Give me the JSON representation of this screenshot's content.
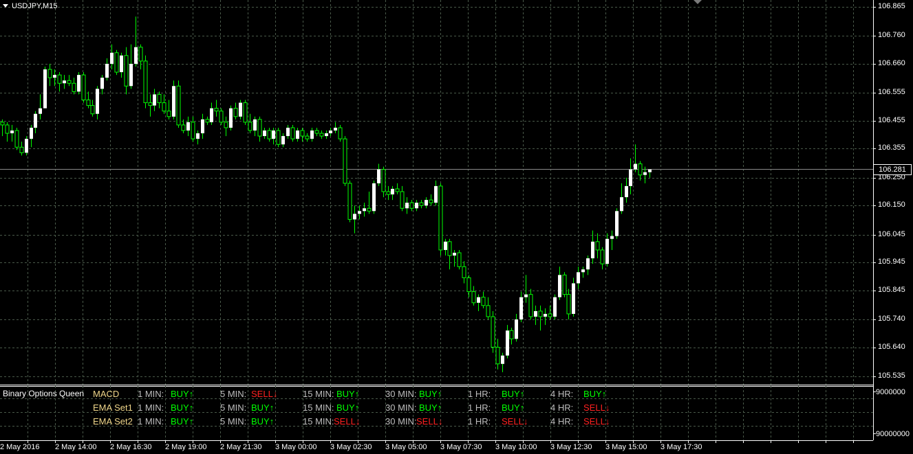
{
  "chart": {
    "symbol_label": "USDJPY,M15",
    "current_price": "106.281",
    "price_labels": [
      "106.865",
      "106.760",
      "106.660",
      "106.555",
      "106.455",
      "106.355",
      "106.250",
      "106.150",
      "106.045",
      "105.945",
      "105.845",
      "105.740",
      "105.640",
      "105.535"
    ],
    "sub_labels": [
      "9000000",
      "90000000"
    ],
    "time_labels": [
      "2 May 2016",
      "2 May 14:00",
      "2 May 16:30",
      "2 May 19:00",
      "2 May 21:30",
      "3 May 00:00",
      "3 May 02:30",
      "3 May 05:00",
      "3 May 07:30",
      "3 May 10:00",
      "3 May 12:30",
      "3 May 15:00",
      "3 May 17:30"
    ],
    "colors": {
      "background": "#000000",
      "grid": "#4a5a4a",
      "bull": "#ffffff",
      "bear": "#000000",
      "wick": "#00ff00",
      "buy": "#00ff00",
      "sell": "#ff2020"
    }
  },
  "chart_data": {
    "type": "candlestick",
    "symbol": "USDJPY",
    "timeframe": "M15",
    "ylim": [
      105.5,
      106.9
    ],
    "x_tick_labels": [
      "2 May 2016",
      "2 May 14:00",
      "2 May 16:30",
      "2 May 19:00",
      "2 May 21:30",
      "3 May 00:00",
      "3 May 02:30",
      "3 May 05:00",
      "3 May 07:30",
      "3 May 10:00",
      "3 May 12:30",
      "3 May 15:00",
      "3 May 17:30"
    ],
    "candles": [
      [
        106.45,
        106.46,
        106.4,
        106.44
      ],
      [
        106.44,
        106.45,
        106.38,
        106.41
      ],
      [
        106.41,
        106.44,
        106.38,
        106.42
      ],
      [
        106.42,
        106.43,
        106.35,
        106.36
      ],
      [
        106.36,
        106.38,
        106.33,
        106.34
      ],
      [
        106.34,
        106.4,
        106.33,
        106.39
      ],
      [
        106.39,
        106.44,
        106.36,
        106.43
      ],
      [
        106.43,
        106.49,
        106.41,
        106.48
      ],
      [
        106.48,
        106.55,
        106.46,
        106.5
      ],
      [
        106.5,
        106.65,
        106.5,
        106.64
      ],
      [
        106.64,
        106.66,
        106.58,
        106.61
      ],
      [
        106.61,
        106.64,
        106.58,
        106.62
      ],
      [
        106.62,
        106.63,
        106.56,
        106.59
      ],
      [
        106.59,
        106.62,
        106.57,
        106.6
      ],
      [
        106.6,
        106.62,
        106.58,
        106.59
      ],
      [
        106.59,
        106.61,
        106.55,
        106.56
      ],
      [
        106.56,
        106.63,
        106.55,
        106.62
      ],
      [
        106.62,
        106.63,
        106.52,
        106.53
      ],
      [
        106.53,
        106.56,
        106.5,
        106.51
      ],
      [
        106.51,
        106.53,
        106.47,
        106.48
      ],
      [
        106.48,
        106.58,
        106.46,
        106.57
      ],
      [
        106.57,
        106.62,
        106.55,
        106.61
      ],
      [
        106.61,
        106.68,
        106.6,
        106.66
      ],
      [
        106.66,
        106.73,
        106.64,
        106.7
      ],
      [
        106.7,
        106.71,
        106.62,
        106.63
      ],
      [
        106.63,
        106.7,
        106.61,
        106.69
      ],
      [
        106.69,
        106.72,
        106.55,
        106.58
      ],
      [
        106.58,
        106.73,
        106.57,
        106.66
      ],
      [
        106.66,
        106.83,
        106.65,
        106.72
      ],
      [
        106.72,
        106.73,
        106.64,
        106.67
      ],
      [
        106.67,
        106.69,
        106.5,
        106.52
      ],
      [
        106.52,
        106.55,
        106.47,
        106.51
      ],
      [
        106.51,
        106.57,
        106.49,
        106.55
      ],
      [
        106.55,
        106.56,
        106.5,
        106.52
      ],
      [
        106.52,
        106.55,
        106.48,
        106.49
      ],
      [
        106.49,
        106.53,
        106.46,
        106.47
      ],
      [
        106.47,
        106.6,
        106.46,
        106.58
      ],
      [
        106.58,
        106.6,
        106.43,
        106.44
      ],
      [
        106.44,
        106.46,
        106.41,
        106.42
      ],
      [
        106.42,
        106.47,
        106.4,
        106.45
      ],
      [
        106.45,
        106.47,
        106.38,
        106.39
      ],
      [
        106.39,
        106.42,
        106.37,
        106.41
      ],
      [
        106.41,
        106.48,
        106.39,
        106.46
      ],
      [
        106.46,
        106.47,
        106.44,
        106.45
      ],
      [
        106.45,
        106.52,
        106.44,
        106.5
      ],
      [
        106.5,
        106.53,
        106.47,
        106.49
      ],
      [
        106.49,
        106.5,
        106.44,
        106.45
      ],
      [
        106.45,
        106.47,
        106.4,
        106.43
      ],
      [
        106.43,
        106.51,
        106.42,
        106.5
      ],
      [
        106.5,
        106.52,
        106.46,
        106.47
      ],
      [
        106.47,
        106.53,
        106.46,
        106.52
      ],
      [
        106.52,
        106.53,
        106.44,
        106.45
      ],
      [
        106.45,
        106.48,
        106.41,
        106.42
      ],
      [
        106.42,
        106.47,
        106.4,
        106.46
      ],
      [
        106.46,
        106.47,
        106.38,
        106.4
      ],
      [
        106.4,
        106.43,
        106.39,
        106.42
      ],
      [
        106.42,
        106.43,
        106.38,
        106.39
      ],
      [
        106.39,
        106.43,
        106.37,
        106.42
      ],
      [
        106.42,
        106.43,
        106.36,
        106.37
      ],
      [
        106.37,
        106.41,
        106.36,
        106.4
      ],
      [
        106.4,
        106.44,
        106.39,
        106.43
      ],
      [
        106.43,
        106.44,
        106.38,
        106.39
      ],
      [
        106.39,
        106.43,
        106.38,
        106.42
      ],
      [
        106.42,
        106.43,
        106.38,
        106.4
      ],
      [
        106.4,
        106.41,
        106.38,
        106.39
      ],
      [
        106.39,
        106.43,
        106.38,
        106.42
      ],
      [
        106.42,
        106.43,
        106.4,
        106.41
      ],
      [
        106.41,
        106.42,
        106.39,
        106.4
      ],
      [
        106.4,
        106.42,
        106.39,
        106.41
      ],
      [
        106.41,
        106.43,
        106.4,
        106.42
      ],
      [
        106.42,
        106.45,
        106.41,
        106.43
      ],
      [
        106.43,
        106.44,
        106.38,
        106.39
      ],
      [
        106.39,
        106.4,
        106.22,
        106.23
      ],
      [
        106.23,
        106.24,
        106.09,
        106.1
      ],
      [
        106.1,
        106.15,
        106.05,
        106.12
      ],
      [
        106.12,
        106.15,
        106.1,
        106.13
      ],
      [
        106.13,
        106.16,
        106.11,
        106.14
      ],
      [
        106.14,
        106.2,
        106.12,
        106.13
      ],
      [
        106.13,
        106.24,
        106.12,
        106.23
      ],
      [
        106.23,
        106.3,
        106.22,
        106.28
      ],
      [
        106.28,
        106.29,
        106.18,
        106.2
      ],
      [
        106.2,
        106.22,
        106.17,
        106.19
      ],
      [
        106.19,
        106.22,
        106.17,
        106.21
      ],
      [
        106.21,
        106.23,
        106.19,
        106.2
      ],
      [
        106.2,
        106.22,
        106.13,
        106.14
      ],
      [
        106.14,
        106.18,
        106.12,
        106.16
      ],
      [
        106.16,
        106.17,
        106.13,
        106.14
      ],
      [
        106.14,
        106.17,
        106.13,
        106.16
      ],
      [
        106.16,
        106.17,
        106.14,
        106.15
      ],
      [
        106.15,
        106.18,
        106.14,
        106.17
      ],
      [
        106.17,
        106.19,
        106.15,
        106.16
      ],
      [
        106.16,
        106.24,
        106.15,
        106.22
      ],
      [
        106.22,
        106.23,
        105.97,
        105.99
      ],
      [
        105.99,
        106.03,
        105.97,
        106.02
      ],
      [
        106.02,
        106.03,
        105.92,
        105.97
      ],
      [
        105.97,
        105.99,
        105.93,
        105.98
      ],
      [
        105.98,
        105.99,
        105.92,
        105.93
      ],
      [
        105.93,
        105.95,
        105.87,
        105.89
      ],
      [
        105.89,
        105.9,
        105.82,
        105.84
      ],
      [
        105.84,
        105.86,
        105.79,
        105.8
      ],
      [
        105.8,
        105.83,
        105.77,
        105.82
      ],
      [
        105.82,
        105.84,
        105.78,
        105.79
      ],
      [
        105.79,
        105.82,
        105.74,
        105.75
      ],
      [
        105.75,
        105.77,
        105.62,
        105.64
      ],
      [
        105.64,
        105.67,
        105.56,
        105.58
      ],
      [
        105.58,
        105.62,
        105.55,
        105.61
      ],
      [
        105.61,
        105.72,
        105.6,
        105.7
      ],
      [
        105.7,
        105.71,
        105.65,
        105.67
      ],
      [
        105.67,
        105.76,
        105.66,
        105.74
      ],
      [
        105.74,
        105.84,
        105.73,
        105.82
      ],
      [
        105.82,
        105.9,
        105.8,
        105.83
      ],
      [
        105.83,
        105.85,
        105.74,
        105.75
      ],
      [
        105.75,
        105.79,
        105.72,
        105.77
      ],
      [
        105.77,
        105.79,
        105.7,
        105.75
      ],
      [
        105.75,
        105.78,
        105.72,
        105.76
      ],
      [
        105.76,
        105.79,
        105.74,
        105.75
      ],
      [
        105.75,
        105.83,
        105.74,
        105.82
      ],
      [
        105.82,
        105.93,
        105.81,
        105.9
      ],
      [
        105.9,
        105.91,
        105.82,
        105.83
      ],
      [
        105.83,
        105.85,
        105.74,
        105.76
      ],
      [
        105.76,
        105.89,
        105.75,
        105.87
      ],
      [
        105.87,
        105.93,
        105.85,
        105.91
      ],
      [
        105.91,
        105.93,
        105.89,
        105.92
      ],
      [
        105.92,
        105.97,
        105.9,
        105.96
      ],
      [
        105.96,
        106.06,
        105.94,
        106.02
      ],
      [
        106.02,
        106.05,
        105.96,
        105.99
      ],
      [
        105.99,
        106.0,
        105.92,
        105.94
      ],
      [
        105.94,
        106.05,
        105.93,
        106.03
      ],
      [
        106.03,
        106.06,
        105.99,
        106.04
      ],
      [
        106.04,
        106.14,
        106.03,
        106.13
      ],
      [
        106.13,
        106.23,
        106.12,
        106.18
      ],
      [
        106.18,
        106.25,
        106.16,
        106.22
      ],
      [
        106.22,
        106.32,
        106.19,
        106.28
      ],
      [
        106.28,
        106.37,
        106.27,
        106.3
      ],
      [
        106.3,
        106.31,
        106.24,
        106.26
      ],
      [
        106.26,
        106.29,
        106.23,
        106.27
      ],
      [
        106.27,
        106.28,
        106.25,
        106.28
      ]
    ]
  },
  "indicator": {
    "title": "Binary Options Queen",
    "rows": [
      {
        "name": "MACD",
        "cells": [
          {
            "label": "1 MIN:",
            "signal": "BUY",
            "dir": "up"
          },
          {
            "label": "5 MIN:",
            "signal": "SELL",
            "dir": "down"
          },
          {
            "label": "15 MIN:",
            "signal": "BUY",
            "dir": "up"
          },
          {
            "label": "30 MIN:",
            "signal": "BUY",
            "dir": "up"
          },
          {
            "label": "1 HR:",
            "signal": "BUY",
            "dir": "up"
          },
          {
            "label": "4 HR:",
            "signal": "BUY",
            "dir": "up"
          }
        ]
      },
      {
        "name": "EMA Set1",
        "cells": [
          {
            "label": "1 MIN:",
            "signal": "BUY",
            "dir": "up"
          },
          {
            "label": "5 MIN:",
            "signal": "BUY",
            "dir": "up"
          },
          {
            "label": "15 MIN:",
            "signal": "BUY",
            "dir": "up"
          },
          {
            "label": "30 MIN:",
            "signal": "BUY",
            "dir": "up"
          },
          {
            "label": "1 HR:",
            "signal": "BUY",
            "dir": "up"
          },
          {
            "label": "4 HR:",
            "signal": "SELL",
            "dir": "down"
          }
        ]
      },
      {
        "name": "EMA Set2",
        "cells": [
          {
            "label": "1 MIN:",
            "signal": "BUY",
            "dir": "up"
          },
          {
            "label": "5 MIN:",
            "signal": "BUY",
            "dir": "up"
          },
          {
            "label": "15 MIN:",
            "signal": "SELL",
            "dir": "down"
          },
          {
            "label": "30 MIN:",
            "signal": "SELL",
            "dir": "down"
          },
          {
            "label": "1 HR:",
            "signal": "SELL",
            "dir": "down"
          },
          {
            "label": "4 HR:",
            "signal": "SELL",
            "dir": "down"
          }
        ]
      }
    ]
  }
}
